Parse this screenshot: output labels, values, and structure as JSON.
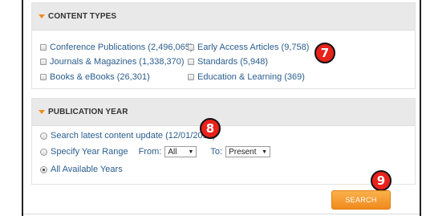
{
  "content_types": {
    "heading": "CONTENT TYPES",
    "items": [
      {
        "label": "Conference Publications (2,496,065)"
      },
      {
        "label": "Journals & Magazines (1,338,370)"
      },
      {
        "label": "Books & eBooks (26,301)"
      },
      {
        "label": "Early Access Articles (9,758)"
      },
      {
        "label": "Standards (5,948)"
      },
      {
        "label": "Education & Learning (369)"
      }
    ]
  },
  "publication_year": {
    "heading": "PUBLICATION YEAR",
    "options": [
      {
        "label": "Search latest content update (12/01/2014)"
      },
      {
        "label": "Specify Year Range"
      },
      {
        "label": "All Available Years"
      }
    ],
    "from_label": "From:",
    "from_value": "All",
    "to_label": "To:",
    "to_value": "Present"
  },
  "search_button": {
    "label": "SEARCH"
  },
  "annotations": {
    "seven": "7",
    "eight": "8",
    "nine": "9"
  },
  "colors": {
    "accent": "#f08a1c",
    "link": "#2a5d8f",
    "badge": "#e8231c"
  }
}
